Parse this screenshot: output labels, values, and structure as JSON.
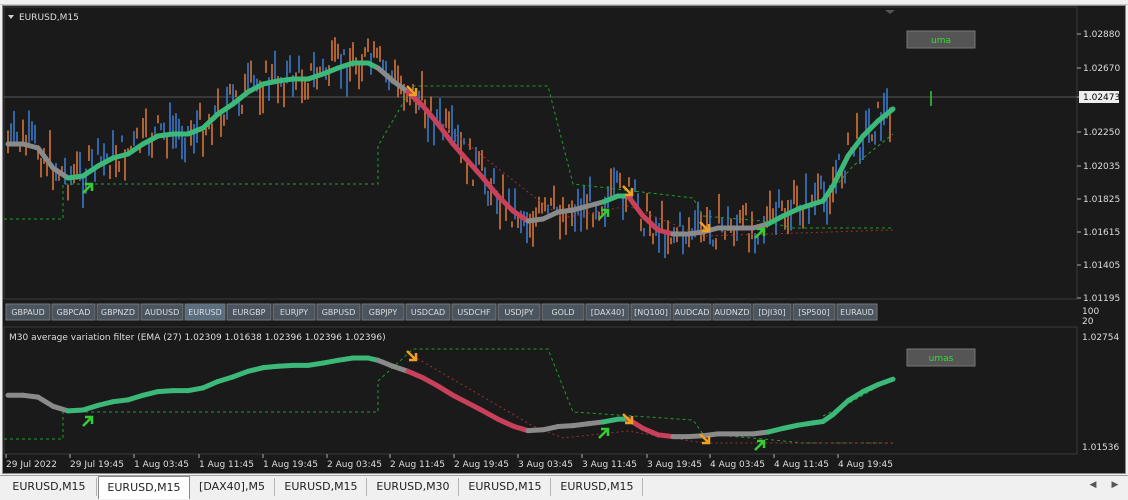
{
  "main_chart": {
    "title": "EURUSD,M15",
    "indicator_label": "uma",
    "price_labels": [
      "1.02880",
      "1.02670",
      "1.02473",
      "1.02250",
      "1.02035",
      "1.01825",
      "1.01615",
      "1.01405",
      "1.01195"
    ],
    "current_price": "1.02473"
  },
  "symbol_buttons": [
    "GBPAUD",
    "GBPCAD",
    "GBPNZD",
    "AUDUSD",
    "EURUSD",
    "EURGBP",
    "EURJPY",
    "GBPUSD",
    "GBPJPY",
    "USDCAD",
    "USDCHF",
    "USDJPY",
    "GOLD",
    "[DAX40]",
    "[NQ100]",
    "AUDCAD",
    "AUDNZD",
    "[DJI30]",
    "[SP500]",
    "EURAUD"
  ],
  "active_symbol": "EURUSD",
  "scale_labels": [
    "100",
    "20"
  ],
  "sub_chart": {
    "title": "M30 average variation filter (EMA (27) 1.02309 1.01638 1.02396 1.02396 1.02396)",
    "indicator_label": "umas",
    "price_labels": [
      "1.02754",
      "1.01536"
    ]
  },
  "time_labels": [
    "29 Jul 2022",
    "29 Jul 19:45",
    "1 Aug 03:45",
    "1 Aug 11:45",
    "1 Aug 19:45",
    "2 Aug 03:45",
    "2 Aug 11:45",
    "2 Aug 19:45",
    "3 Aug 03:45",
    "3 Aug 11:45",
    "3 Aug 19:45",
    "4 Aug 03:45",
    "4 Aug 11:45",
    "4 Aug 19:45"
  ],
  "tabs": [
    "EURUSD,M15",
    "EURUSD,M15",
    "[DAX40],M5",
    "EURUSD,M15",
    "EURUSD,M30",
    "EURUSD,M15",
    "EURUSD,M15"
  ],
  "active_tab": 1,
  "colors": {
    "background": "#1a1a1a",
    "bull_candle": "#3a7fd5",
    "bear_candle": "#e07a3a",
    "ma_up": "#3cb878",
    "ma_down": "#c8405a",
    "ma_flat": "#8a8a8a",
    "arrow_up": "#33cc33",
    "arrow_down": "#f0a020"
  }
}
